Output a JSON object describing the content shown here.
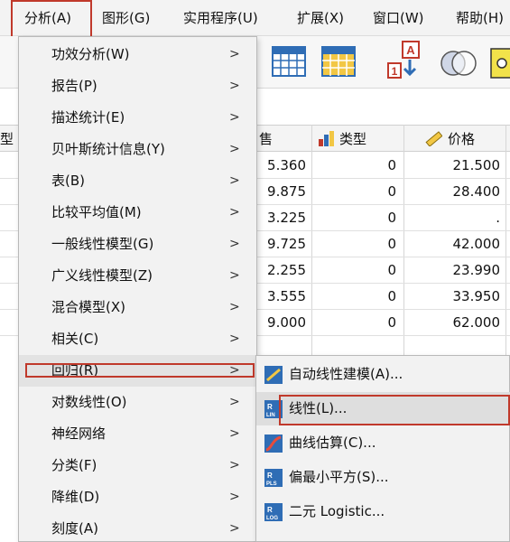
{
  "menubar": {
    "items": [
      "分析(A)",
      "图形(G)",
      "实用程序(U)",
      "扩展(X)",
      "窗口(W)",
      "帮助(H)"
    ]
  },
  "grid": {
    "left_cut_header": "型",
    "columns": {
      "sales": "售",
      "type": "类型",
      "price": "价格"
    },
    "rows": [
      {
        "sales": "5.360",
        "type": "0",
        "price": "21.500"
      },
      {
        "sales": "9.875",
        "type": "0",
        "price": "28.400"
      },
      {
        "sales": "3.225",
        "type": "0",
        "price": "."
      },
      {
        "sales": "9.725",
        "type": "0",
        "price": "42.000"
      },
      {
        "sales": "2.255",
        "type": "0",
        "price": "23.990"
      },
      {
        "sales": "3.555",
        "type": "0",
        "price": "33.950"
      },
      {
        "sales": "9.000",
        "type": "0",
        "price": "62.000"
      }
    ]
  },
  "analyze_menu": {
    "items": [
      "功效分析(W)",
      "报告(P)",
      "描述统计(E)",
      "贝叶斯统计信息(Y)",
      "表(B)",
      "比较平均值(M)",
      "一般线性模型(G)",
      "广义线性模型(Z)",
      "混合模型(X)",
      "相关(C)",
      "回归(R)",
      "对数线性(O)",
      "神经网络",
      "分类(F)",
      "降维(D)",
      "刻度(A)"
    ],
    "submenu_arrow": ">"
  },
  "regression_submenu": {
    "items": [
      {
        "label": "自动线性建模(A)...",
        "icon": "auto-linear-icon"
      },
      {
        "label": "线性(L)...",
        "icon": "linear-regression-icon"
      },
      {
        "label": "曲线估算(C)...",
        "icon": "curve-estimation-icon"
      },
      {
        "label": "偏最小平方(S)...",
        "icon": "pls-icon"
      },
      {
        "label": "二元 Logistic...",
        "icon": "binary-logistic-icon"
      }
    ]
  },
  "colors": {
    "highlight_border": "#c0392b",
    "icon_blue": "#2f6db5",
    "icon_yellow": "#f2c744"
  }
}
